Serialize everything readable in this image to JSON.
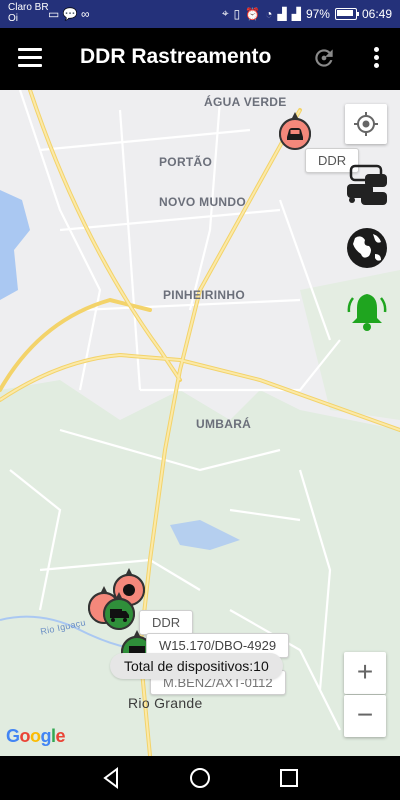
{
  "status_bar": {
    "carrier_line1": "Claro BR",
    "carrier_line2": "Oi",
    "left_icons": "▭ 💬 ∞",
    "battery": "97%",
    "time": "06:49",
    "color": "#24317a"
  },
  "app_bar": {
    "title": "DDR Rastreamento",
    "menu_icon": "hamburger-menu-icon",
    "refresh_icon": "refresh-icon",
    "more_icon": "more-vertical-icon"
  },
  "map": {
    "places": {
      "agua_verde": "ÁGUA VERDE",
      "portao": "PORTÃO",
      "novo_mundo": "NOVO MUNDO",
      "pinheirinho": "PINHEIRINHO",
      "umbara": "UMBARÁ",
      "rio_iguacu": "Rio Iguaçu",
      "rio_grande": "Rio Grande"
    },
    "google": "Google",
    "top_bubble": "DDR",
    "bottom_bubble_ddr": "DDR",
    "bottom_bubble_plate": "W15.170/DBO-4929",
    "bottom_bubble_model": "M.BENZ/AXT-0112",
    "toast": "Total de dispositivos:10",
    "zoom_in": "+",
    "zoom_out": "−"
  },
  "colors": {
    "marker_red": "#f4887b",
    "marker_green": "#2f8f3a",
    "bell_green": "#1fa51f",
    "road_yellow": "#f7dc7a"
  }
}
